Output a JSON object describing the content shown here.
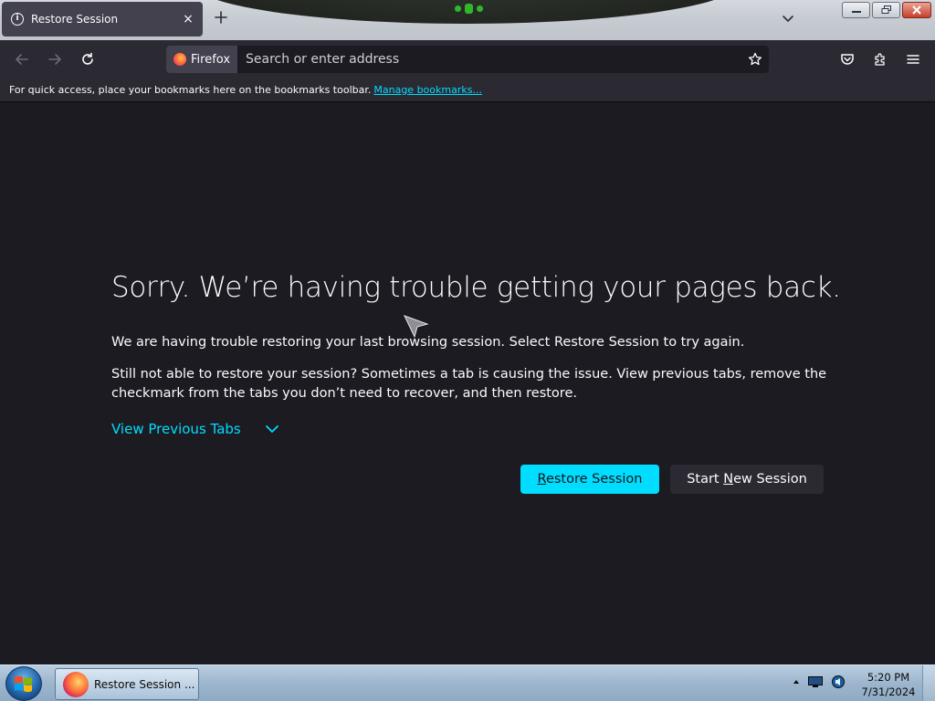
{
  "tab": {
    "title": "Restore Session",
    "icon": "info-icon",
    "close_glyph": "×"
  },
  "toolbar": {
    "identity_label": "Firefox",
    "search_placeholder": "Search or enter address"
  },
  "bookmarks_bar": {
    "message": "For quick access, place your bookmarks here on the bookmarks toolbar.",
    "manage_link": "Manage bookmarks..."
  },
  "main": {
    "heading": "Sorry. We’re having trouble getting your pages back.",
    "paragraph1": "We are having trouble restoring your last browsing session. Select Restore Session to try again.",
    "paragraph2": "Still not able to restore your session? Sometimes a tab is causing the issue. View previous tabs, remove the checkmark from the tabs you don’t need to recover, and then restore.",
    "view_previous_tabs": "View Previous Tabs",
    "restore_button": {
      "before": "",
      "access_key": "R",
      "after": "estore Session"
    },
    "new_session_button": {
      "before": "Start ",
      "access_key": "N",
      "after": "ew Session"
    }
  },
  "taskbar": {
    "task_label": "Restore Session ...",
    "time": "5:20 PM",
    "date": "7/31/2024"
  },
  "colors": {
    "accent": "#00ddff",
    "page_bg": "#1c1b22",
    "toolbar_bg": "#2b2a33",
    "text": "#fbfbfe"
  }
}
